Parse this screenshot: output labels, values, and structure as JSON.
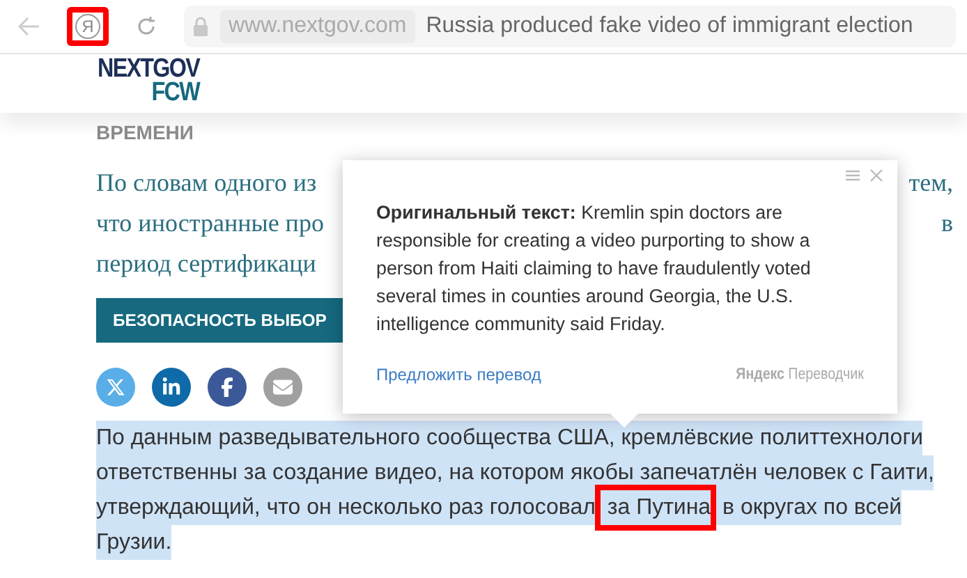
{
  "browser": {
    "yandex_button": {
      "label": "Я",
      "annotated": true
    },
    "url": "www.nextgov.com",
    "tab_title": "Russia produced fake video of immigrant election"
  },
  "logo": {
    "line1": "NEXTGOV",
    "line2": "FCW"
  },
  "section_label": "ВРЕМЕНИ",
  "intro_lines": [
    {
      "left": "По словам одного из",
      "right": "тем,"
    },
    {
      "left": "что иностранные про",
      "right": "в"
    },
    {
      "left": "период сертификаци"
    }
  ],
  "tag_button": "БЕЗОПАСНОСТЬ ВЫБОР",
  "share_buttons": [
    {
      "kind": "x"
    },
    {
      "kind": "linkedin"
    },
    {
      "kind": "facebook"
    },
    {
      "kind": "email"
    }
  ],
  "translation_popup": {
    "label": "Оригинальный текст:",
    "text": "Kremlin spin doctors are responsible for creating a video purporting to show a person from Haiti claiming to have fraudulently voted several times in counties around Georgia, the U.S. intelligence community said Friday.",
    "suggest_link": "Предложить перевод",
    "brand": "Яндекс",
    "brand_product": "Переводчик"
  },
  "selected_paragraph": [
    {
      "segments": [
        {
          "text": "По данным разведывательного сообщества США, кремлёвские политтехнологи",
          "annotated": false
        }
      ]
    },
    {
      "segments": [
        {
          "text": "ответственны за создание видео, на котором якобы запечатлён человек с Гаити,",
          "annotated": false
        }
      ]
    },
    {
      "segments": [
        {
          "text": "утверждающий, что он несколько раз голосовал",
          "annotated": false
        },
        {
          "text": "за Путина",
          "annotated": true
        },
        {
          "text": "в округах по всей",
          "annotated": false
        }
      ]
    },
    {
      "segments": [
        {
          "text": "Грузии.",
          "annotated": false
        }
      ]
    }
  ]
}
